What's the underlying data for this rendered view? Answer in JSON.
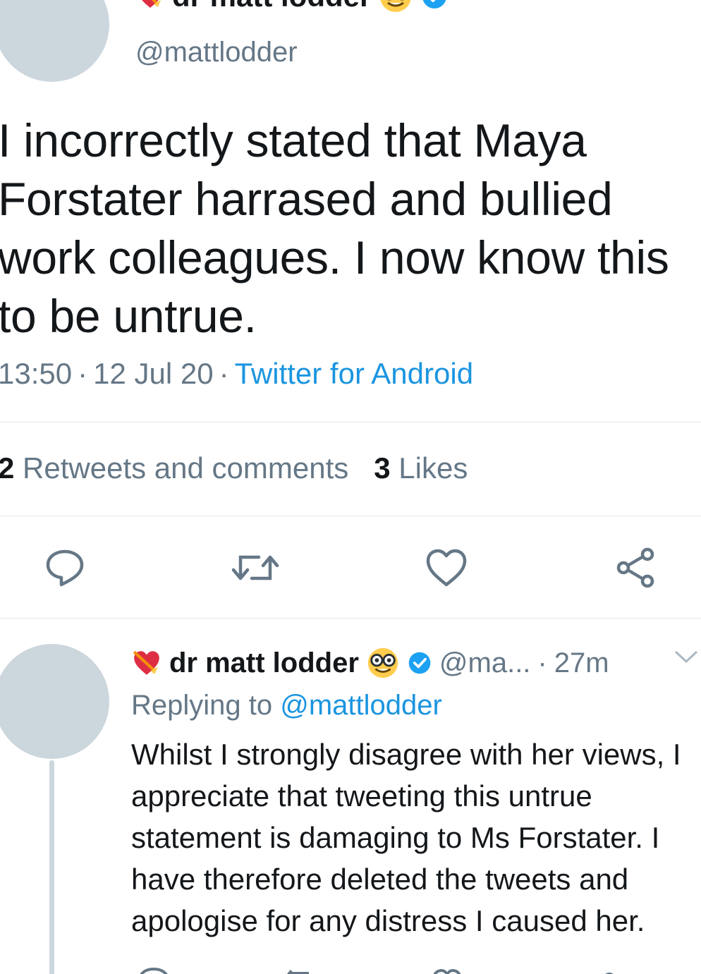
{
  "main_tweet": {
    "author_name": "dr matt lodder",
    "handle": "@mattlodder",
    "text": "I incorrectly stated that Maya Forstater harrased and bullied work colleagues. I now know this to be untrue.",
    "time": "13:50",
    "date": "12 Jul 20",
    "source": "Twitter for Android",
    "separator": "·",
    "retweets_count": "2",
    "retweets_label": "Retweets and comments",
    "likes_count": "3",
    "likes_label": "Likes",
    "icons": [
      "heart-with-arrow-icon",
      "nerd-face-icon",
      "verified-badge-icon",
      "reply-icon",
      "retweet-icon",
      "like-icon",
      "share-icon",
      "chevron-down-icon"
    ]
  },
  "reply_tweet": {
    "author_name": "dr matt lodder",
    "handle": "@ma...",
    "separator": "·",
    "time_ago": "27m",
    "replying_prefix": "Replying to",
    "replying_to": "@mattlodder",
    "text": "Whilst I strongly disagree with her views, I appreciate that tweeting this untrue statement is damaging to Ms Forstater. I have therefore deleted the tweets and apologise for any distress I caused her."
  },
  "colors": {
    "text": "#14171a",
    "secondary": "#657786",
    "link": "#1b95e0",
    "verified": "#1da1f2",
    "avatar": "#ccd6dd",
    "divider": "#e1e8ed"
  }
}
